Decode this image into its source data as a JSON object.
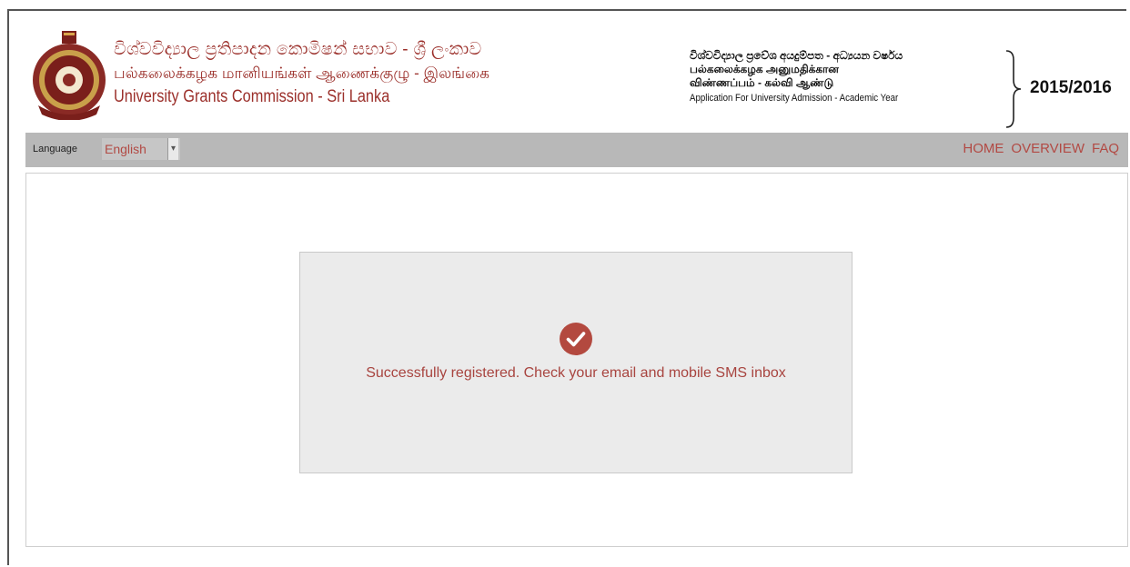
{
  "header": {
    "title_sinhala": "විශ්වවිද්‍යාල ප්‍රතිපාදන කොමිෂන් සභාව - ශ්‍රී ලංකාව",
    "title_tamil": "பல்கலைக்கழக மானியங்கள் ஆணைக்குழு - இலங்கை",
    "title_english": "University Grants Commission - Sri Lanka",
    "app_sinhala": "විශ්වවිද්‍යාල ප්‍රවේශ අයදුම්පත - අධ්‍යයන වර්ෂය",
    "app_tamil_1": "பல்கலைக்கழக அனுமதிக்கான",
    "app_tamil_2": "விண்ணப்பம் - கல்வி ஆண்டு",
    "app_english": "Application For University Admission - Academic Year",
    "year": "2015/2016",
    "logo_icon": "ugc-emblem-icon",
    "brand_color": "#9b2f2a"
  },
  "navbar": {
    "language_label": "Language",
    "language_selected": "English",
    "language_caret_icon": "chevron-down-icon",
    "links": [
      "HOME",
      "OVERVIEW",
      "FAQ"
    ],
    "background": "#b8b8b8",
    "link_color": "#b24a44"
  },
  "main": {
    "success_icon": "check-circle-icon",
    "message": "Successfully registered. Check your email and mobile SMS inbox",
    "message_color": "#a8443f",
    "panel_background": "#ebebeb"
  }
}
